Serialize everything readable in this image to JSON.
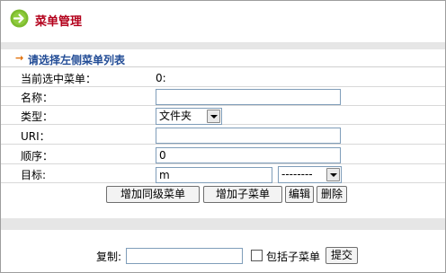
{
  "header": {
    "title": "菜单管理"
  },
  "panel": {
    "arrow": "→",
    "title": "请选择左侧菜单列表",
    "current_menu_label": "当前选中菜单：",
    "current_menu_value": "0:",
    "name_label": "名称：",
    "name_value": "",
    "type_label": "类型：",
    "type_selected": "文件夹",
    "uri_label": "URI：",
    "uri_value": "",
    "order_label": "顺序：",
    "order_value": "0",
    "target_label": "目标:",
    "target_value": "m",
    "target_select": "--------",
    "buttons": {
      "add_sibling": "增加同级菜单",
      "add_child": "增加子菜单",
      "edit": "编辑",
      "delete": "删除"
    }
  },
  "footer": {
    "copy_label": "复制:",
    "copy_value": "",
    "include_children_label": "包括子菜单",
    "include_children_checked": false,
    "submit": "提交"
  },
  "colors": {
    "title_red": "#b3001b",
    "icon_green": "#7dbb2f",
    "link_blue": "#224c96",
    "band_gray": "#e6e6e6"
  }
}
